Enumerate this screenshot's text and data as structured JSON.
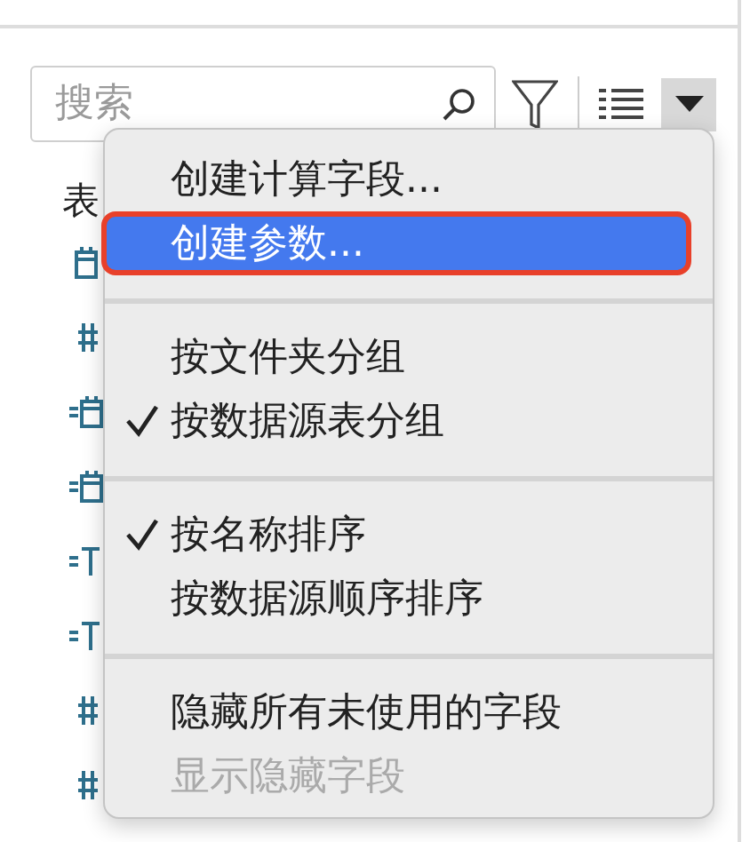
{
  "search": {
    "placeholder": "搜索"
  },
  "fields": {
    "heading": "表",
    "rows": [
      {
        "kind": "date"
      },
      {
        "kind": "number"
      },
      {
        "kind": "calc-date"
      },
      {
        "kind": "calc-date"
      },
      {
        "kind": "calc-text"
      },
      {
        "kind": "calc-text"
      },
      {
        "kind": "number"
      },
      {
        "kind": "number"
      }
    ]
  },
  "menu": {
    "items": [
      {
        "kind": "item",
        "label": "创建计算字段...",
        "checked": false,
        "disabled": false,
        "selected": false,
        "outlined": false
      },
      {
        "kind": "item",
        "label": "创建参数...",
        "checked": false,
        "disabled": false,
        "selected": true,
        "outlined": true
      },
      {
        "kind": "separator"
      },
      {
        "kind": "item",
        "label": "按文件夹分组",
        "checked": false,
        "disabled": false,
        "selected": false,
        "outlined": false
      },
      {
        "kind": "item",
        "label": "按数据源表分组",
        "checked": true,
        "disabled": false,
        "selected": false,
        "outlined": false
      },
      {
        "kind": "separator"
      },
      {
        "kind": "item",
        "label": "按名称排序",
        "checked": true,
        "disabled": false,
        "selected": false,
        "outlined": false
      },
      {
        "kind": "item",
        "label": "按数据源顺序排序",
        "checked": false,
        "disabled": false,
        "selected": false,
        "outlined": false
      },
      {
        "kind": "separator"
      },
      {
        "kind": "item",
        "label": "隐藏所有未使用的字段",
        "checked": false,
        "disabled": false,
        "selected": false,
        "outlined": false
      },
      {
        "kind": "item",
        "label": "显示隐藏字段",
        "checked": false,
        "disabled": true,
        "selected": false,
        "outlined": false
      }
    ]
  }
}
